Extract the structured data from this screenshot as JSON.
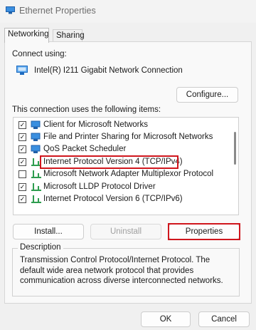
{
  "window": {
    "title": "Ethernet Properties",
    "icon": "network-adapter-icon"
  },
  "tabs": [
    {
      "label": "Networking",
      "active": true
    },
    {
      "label": "Sharing",
      "active": false
    }
  ],
  "connect_using": {
    "label": "Connect using:",
    "adapter_name": "Intel(R) I211 Gigabit Network Connection",
    "adapter_icon": "network-adapter-icon"
  },
  "buttons": {
    "configure": "Configure...",
    "install": "Install...",
    "uninstall": "Uninstall",
    "properties": "Properties",
    "ok": "OK",
    "cancel": "Cancel"
  },
  "items_label": "This connection uses the following items:",
  "items": [
    {
      "label": "Client for Microsoft Networks",
      "checked": true,
      "icon": "network-client-icon"
    },
    {
      "label": "File and Printer Sharing for Microsoft Networks",
      "checked": true,
      "icon": "network-service-icon"
    },
    {
      "label": "QoS Packet Scheduler",
      "checked": true,
      "icon": "network-service-icon"
    },
    {
      "label": "Internet Protocol Version 4 (TCP/IPv4)",
      "checked": true,
      "icon": "network-protocol-icon",
      "highlighted": true
    },
    {
      "label": "Microsoft Network Adapter Multiplexor Protocol",
      "checked": false,
      "icon": "network-protocol-icon"
    },
    {
      "label": "Microsoft LLDP Protocol Driver",
      "checked": true,
      "icon": "network-protocol-icon"
    },
    {
      "label": "Internet Protocol Version 6 (TCP/IPv6)",
      "checked": true,
      "icon": "network-protocol-icon"
    }
  ],
  "description": {
    "title": "Description",
    "text": "Transmission Control Protocol/Internet Protocol. The default wide area network protocol that provides communication across diverse interconnected networks."
  },
  "colors": {
    "highlight": "#d0161d",
    "client_icon": "#1f7bd6",
    "protocol_icon": "#2e9d4f"
  }
}
